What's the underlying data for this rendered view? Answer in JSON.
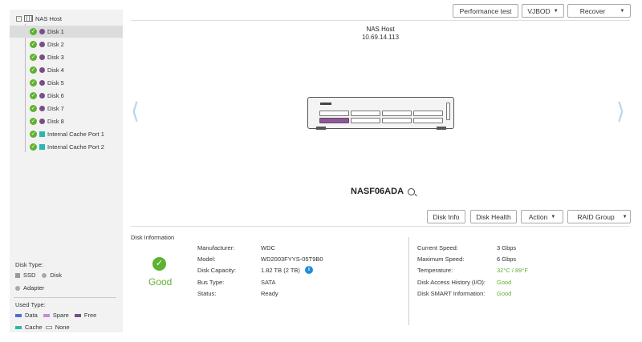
{
  "tree": {
    "root": "NAS Host",
    "items": [
      {
        "label": "Disk 1",
        "kind": "disk"
      },
      {
        "label": "Disk 2",
        "kind": "disk"
      },
      {
        "label": "Disk 3",
        "kind": "disk"
      },
      {
        "label": "Disk 4",
        "kind": "disk"
      },
      {
        "label": "Disk 5",
        "kind": "disk"
      },
      {
        "label": "Disk 6",
        "kind": "disk"
      },
      {
        "label": "Disk 7",
        "kind": "disk"
      },
      {
        "label": "Disk 8",
        "kind": "disk"
      },
      {
        "label": "Internal Cache Port 1",
        "kind": "cache"
      },
      {
        "label": "Internal Cache Port 2",
        "kind": "cache"
      }
    ],
    "selected": "Disk 1"
  },
  "legend": {
    "disk_type_title": "Disk Type:",
    "ssd": "SSD",
    "disk": "Disk",
    "adapter": "Adapter",
    "used_type_title": "Used Type:",
    "data": "Data",
    "spare": "Spare",
    "free": "Free",
    "cache": "Cache",
    "none": "None",
    "colors": {
      "data": "#4f6fd6",
      "spare": "#c98ad6",
      "free": "#7b4b8a",
      "cache": "#29b8b0",
      "none": "#ffffff"
    }
  },
  "toolbar": {
    "performance_test": "Performance test",
    "vjbod": "VJBOD",
    "recover": "Recover"
  },
  "host": {
    "title": "NAS Host",
    "ip": "10.69.14.113",
    "name": "NASF06ADA"
  },
  "disk_toolbar": {
    "disk_info": "Disk Info",
    "disk_health": "Disk Health",
    "action": "Action",
    "raid_group": "RAID Group"
  },
  "disk_info": {
    "section_title": "Disk Information",
    "status_text": "Good",
    "left": [
      {
        "label": "Manufacturer:",
        "value": "WDC"
      },
      {
        "label": "Model:",
        "value": "WD2003FYYS-05T9B0"
      },
      {
        "label": "Disk Capacity:",
        "value": "1.82 TB (2 TB)"
      },
      {
        "label": "Bus Type:",
        "value": "SATA"
      },
      {
        "label": "Status:",
        "value": "Ready"
      }
    ],
    "right": [
      {
        "label": "Current Speed:",
        "value": "3 Gbps"
      },
      {
        "label": "Maximum Speed:",
        "value": "6 Gbps"
      },
      {
        "label": "Temperature:",
        "value": "32°C / 89°F"
      },
      {
        "label": "Disk Access History (I/O):",
        "value": "Good"
      },
      {
        "label": "Disk SMART Information:",
        "value": "Good"
      }
    ]
  },
  "icons": {
    "status_ok": "check-circle-icon",
    "info": "info-icon",
    "zoom": "zoom-in-icon",
    "prev": "chevron-left-icon",
    "next": "chevron-right-icon"
  }
}
